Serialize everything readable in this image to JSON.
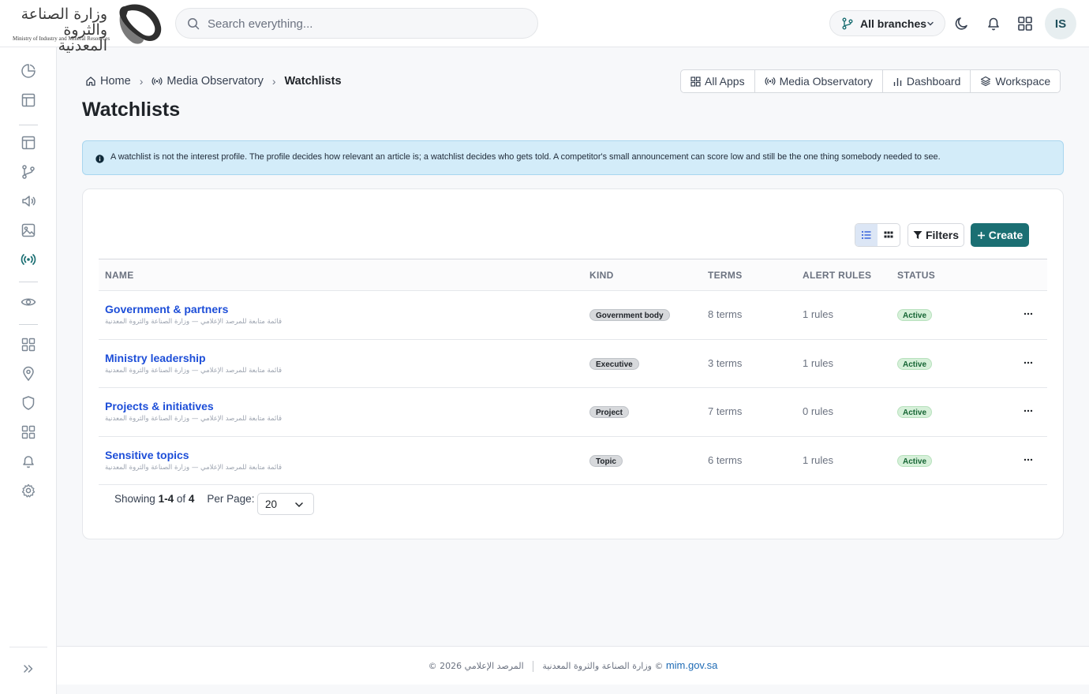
{
  "brand": {
    "logo_text_ar": "وزارة الصناعة والثروة المعدنية",
    "logo_text_en": "Ministry of Industry and Mineral Resources"
  },
  "search": {
    "placeholder": "Search everything..."
  },
  "header": {
    "branch_label": "All branches",
    "avatar_initials": "IS"
  },
  "breadcrumb": {
    "home": "Home",
    "section": "Media Observatory",
    "current": "Watchlists"
  },
  "page": {
    "title": "Watchlists"
  },
  "app_switcher": [
    "All Apps",
    "Media Observatory",
    "Dashboard",
    "Workspace"
  ],
  "info_alert": "A watchlist is not the interest profile. The profile decides how relevant an article is; a watchlist decides who gets told. A competitor's small announcement can score low and still be the one thing somebody needed to see.",
  "toolbar": {
    "filters_label": "Filters",
    "create_label": "Create"
  },
  "table": {
    "columns": [
      "NAME",
      "KIND",
      "TERMS",
      "ALERT RULES",
      "STATUS"
    ],
    "rows": [
      {
        "name": "Government & partners",
        "subtitle": "قائمة متابعة للمرصد الإعلامي — وزارة الصناعة والثروة المعدنية",
        "kind": "Government body",
        "terms": "8 terms",
        "rules": "1 rules",
        "status": "Active"
      },
      {
        "name": "Ministry leadership",
        "subtitle": "قائمة متابعة للمرصد الإعلامي — وزارة الصناعة والثروة المعدنية",
        "kind": "Executive",
        "terms": "3 terms",
        "rules": "1 rules",
        "status": "Active"
      },
      {
        "name": "Projects & initiatives",
        "subtitle": "قائمة متابعة للمرصد الإعلامي — وزارة الصناعة والثروة المعدنية",
        "kind": "Project",
        "terms": "7 terms",
        "rules": "0 rules",
        "status": "Active"
      },
      {
        "name": "Sensitive topics",
        "subtitle": "قائمة متابعة للمرصد الإعلامي — وزارة الصناعة والثروة المعدنية",
        "kind": "Topic",
        "terms": "6 terms",
        "rules": "1 rules",
        "status": "Active"
      }
    ]
  },
  "pagination": {
    "showing": "Showing",
    "range_start": "1",
    "range_end": "4",
    "of": "of",
    "total": "4",
    "per_page_label": "Per Page:",
    "per_page_value": "20"
  },
  "footer": {
    "copyright": "© 2026 وزارة الصناعة والثروة المعدنية",
    "observatory": "المرصد الإعلامي ©",
    "site": "mim.gov.sa"
  },
  "colors": {
    "accent": "#1b6f73",
    "link": "#1d4ed8",
    "info_bg": "#d3ecf9",
    "active_bg": "#d6f0d9"
  },
  "icons": {
    "sidebar": [
      "pie-chart-icon",
      "layout-icon",
      "layout-icon",
      "git-branch-icon",
      "megaphone-icon",
      "image-icon",
      "broadcast-icon",
      "eye-icon",
      "grid-icon",
      "map-pin-icon",
      "shield-icon",
      "grid-icon",
      "bell-icon",
      "gear-icon"
    ]
  }
}
